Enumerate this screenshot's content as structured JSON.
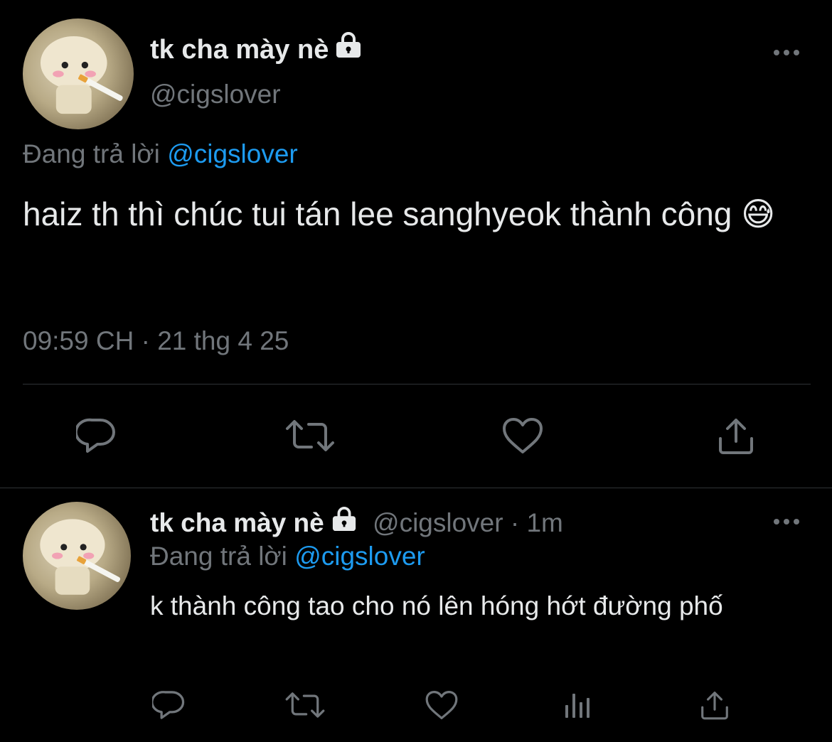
{
  "main_tweet": {
    "display_name": "tk cha mày nè",
    "handle": "@cigslover",
    "replying_prefix": "Đang trả lời",
    "replying_to": "@cigslover",
    "text": "haiz th thì chúc tui tán lee sanghyeok thành công 😅",
    "timestamp": "09:59 CH · 21 thg 4 25",
    "actions": [
      "reply-icon",
      "retweet-icon",
      "like-icon",
      "share-icon"
    ]
  },
  "reply_tweet": {
    "display_name": "tk cha mày nè",
    "handle": "@cigslover",
    "separator": "·",
    "age": "1m",
    "replying_prefix": "Đang trả lời",
    "replying_to": "@cigslover",
    "text": "k thành công tao cho nó lên hóng hớt đường phố",
    "actions": [
      "reply-icon",
      "retweet-icon",
      "like-icon",
      "views-icon",
      "share-icon"
    ]
  },
  "colors": {
    "background": "#000000",
    "text": "#e7e9ea",
    "secondary": "#71767b",
    "accent": "#1d9bf0",
    "divider": "#2f3336"
  }
}
